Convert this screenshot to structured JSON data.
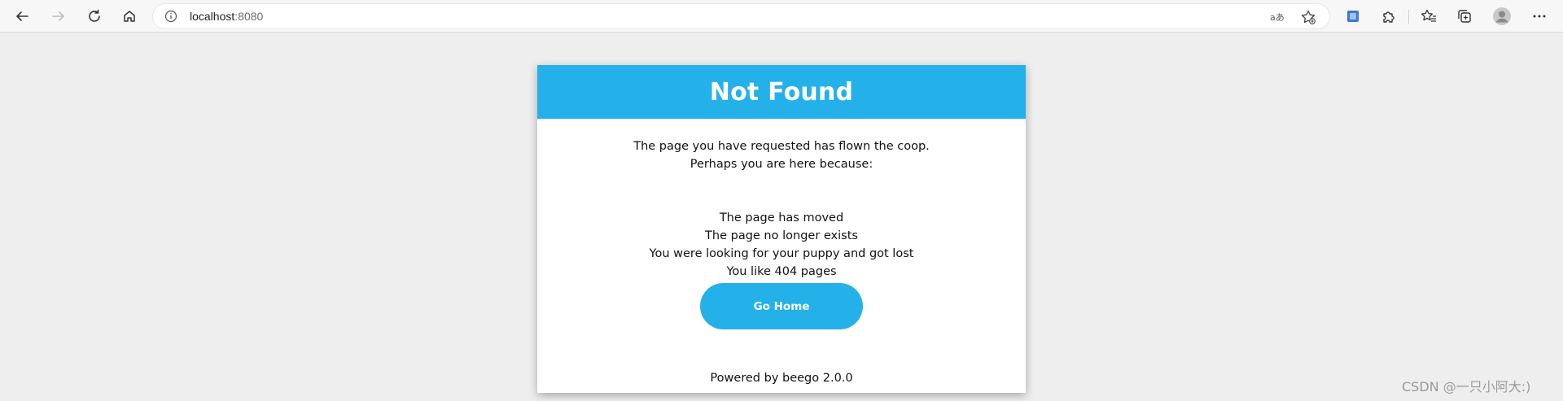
{
  "browser": {
    "address": {
      "host": "localhost",
      "port": ":8080"
    },
    "icons": {
      "back": "arrow-left-icon",
      "forward": "arrow-right-icon",
      "refresh": "refresh-icon",
      "home": "home-icon",
      "site_info": "info-icon",
      "read_aloud": "read-aloud-icon",
      "favorite": "add-favorite-icon",
      "extension": "extension-icon",
      "extensions": "puzzle-icon",
      "favorites": "favorites-icon",
      "collections": "collections-icon",
      "profile": "profile-icon",
      "more": "more-icon"
    }
  },
  "page": {
    "title": "Not Found",
    "intro_line1": "The page you have requested has flown the coop.",
    "intro_line2": "Perhaps you are here because:",
    "reasons": [
      "The page has moved",
      "The page no longer exists",
      "You were looking for your puppy and got lost",
      "You like 404 pages"
    ],
    "button_label": "Go Home",
    "footer": "Powered by beego 2.0.0"
  },
  "watermark": "CSDN @一只小阿大:)",
  "colors": {
    "accent": "#24b1e9",
    "page_bg": "#eeeeee",
    "card_bg": "#ffffff"
  }
}
